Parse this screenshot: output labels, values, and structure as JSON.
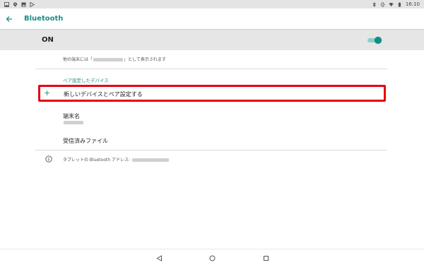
{
  "status_bar": {
    "time": "16:10",
    "left_icons": [
      "image-icon",
      "map-pin-icon",
      "gallery-icon",
      "play-store-icon"
    ],
    "right_icons": [
      "bluetooth-icon",
      "vibrate-icon",
      "wifi-icon",
      "battery-icon"
    ]
  },
  "app_bar": {
    "title": "Bluetooth"
  },
  "toggle_bar": {
    "label": "ON",
    "enabled": true
  },
  "visibility": {
    "prefix": "他の端末には「",
    "suffix": "」として表示されます"
  },
  "paired_section": {
    "header": "ペア設定したデバイス"
  },
  "pair_new": {
    "label": "新しいデバイスとペア設定する"
  },
  "device_name": {
    "title": "端末名"
  },
  "received_files": {
    "title": "受信済みファイル"
  },
  "address": {
    "label": "タブレットの Bluetooth アドレス: "
  },
  "nav": {
    "icons": [
      "back-triangle-icon",
      "home-circle-icon",
      "recents-square-icon"
    ]
  },
  "colors": {
    "accent": "#1a8c84",
    "highlight_border": "#e60012",
    "toggle_bar_bg": "#e6e6e6"
  }
}
